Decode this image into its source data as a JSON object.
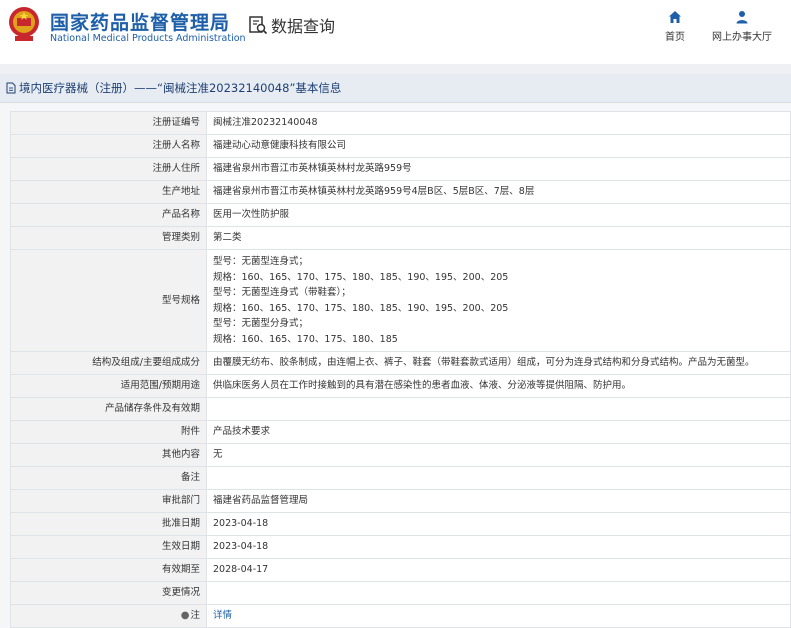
{
  "header": {
    "site_name_cn": "国家药品监督管理局",
    "site_name_en": "National Medical Products Administration",
    "section_title": "数据查询",
    "nav": [
      {
        "label": "首页",
        "icon": "home-icon"
      },
      {
        "label": "网上办事大厅",
        "icon": "user-icon"
      }
    ]
  },
  "title_bar": {
    "text": "境内医疗器械（注册）——“闽械注准20232140048”基本信息"
  },
  "details": [
    {
      "label": "注册证编号",
      "value": "闽械注准20232140048"
    },
    {
      "label": "注册人名称",
      "value": "福建动心动意健康科技有限公司"
    },
    {
      "label": "注册人住所",
      "value": "福建省泉州市晋江市英林镇英林村龙英路959号"
    },
    {
      "label": "生产地址",
      "value": "福建省泉州市晋江市英林镇英林村龙英路959号4层B区、5层B区、7层、8层"
    },
    {
      "label": "产品名称",
      "value": "医用一次性防护服"
    },
    {
      "label": "管理类别",
      "value": "第二类"
    },
    {
      "label": "型号规格",
      "lines": [
        "型号：无菌型连身式；",
        "规格：160、165、170、175、180、185、190、195、200、205",
        "型号：无菌型连身式（带鞋套）；",
        "规格：160、165、170、175、180、185、190、195、200、205",
        "型号：无菌型分身式；",
        "规格：160、165、170、175、180、185"
      ]
    },
    {
      "label": "结构及组成/主要组成成分",
      "value": "由覆膜无纺布、胶条制成，由连帽上衣、裤子、鞋套（带鞋套款式适用）组成，可分为连身式结构和分身式结构。产品为无菌型。"
    },
    {
      "label": "适用范围/预期用途",
      "value": "供临床医务人员在工作时接触到的具有潜在感染性的患者血液、体液、分泌液等提供阻隔、防护用。"
    },
    {
      "label": "产品储存条件及有效期",
      "value": ""
    },
    {
      "label": "附件",
      "value": "产品技术要求"
    },
    {
      "label": "其他内容",
      "value": "无"
    },
    {
      "label": "备注",
      "value": ""
    },
    {
      "label": "审批部门",
      "value": "福建省药品监督管理局"
    },
    {
      "label": "批准日期",
      "value": "2023-04-18"
    },
    {
      "label": "生效日期",
      "value": "2023-04-18"
    },
    {
      "label": "有效期至",
      "value": "2028-04-17"
    },
    {
      "label": "变更情况",
      "value": ""
    },
    {
      "label": "注",
      "value": "详情",
      "is_link": true,
      "icon": "location-pin-icon"
    }
  ]
}
